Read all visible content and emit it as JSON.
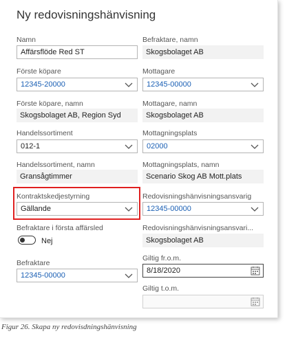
{
  "title": "Ny redovisningshänvisning",
  "left": {
    "namn": {
      "label": "Namn",
      "value": "Affärsflöde Red ST"
    },
    "forste_kopare": {
      "label": "Förste köpare",
      "value": "12345-20000"
    },
    "forste_kopare_namn": {
      "label": "Förste köpare, namn",
      "value": "Skogsbolaget AB, Region Syd"
    },
    "handelssortiment": {
      "label": "Handelssortiment",
      "value": "012-1"
    },
    "handelssortiment_namn": {
      "label": "Handelssortiment, namn",
      "value": "Gransågtimmer"
    },
    "kontraktskedjestyrning": {
      "label": "Kontraktskedjestyrning",
      "value": "Gällande"
    },
    "befraktare_forsta": {
      "label": "Befraktare i första affärsled",
      "value": "Nej"
    },
    "befraktare": {
      "label": "Befraktare",
      "value": "12345-00000"
    }
  },
  "right": {
    "befraktare_namn": {
      "label": "Befraktare, namn",
      "value": "Skogsbolaget AB"
    },
    "mottagare": {
      "label": "Mottagare",
      "value": "12345-00000"
    },
    "mottagare_namn": {
      "label": "Mottagare, namn",
      "value": "Skogsbolaget AB"
    },
    "mottagningsplats": {
      "label": "Mottagningsplats",
      "value": "02000"
    },
    "mottagningsplats_namn": {
      "label": "Mottagningsplats, namn",
      "value": "Scenario Skog AB Mott.plats"
    },
    "redovisningsansvarig": {
      "label": "Redovisningshänvisningsansvarig",
      "value": "12345-00000"
    },
    "redovisningsansvarig_namn": {
      "label": "Redovisningshänvisningsansvari...",
      "value": "Skogsbolaget AB"
    },
    "giltig_from": {
      "label": "Giltig fr.o.m.",
      "value": "8/18/2020"
    },
    "giltig_tom": {
      "label": "Giltig t.o.m.",
      "value": ""
    }
  },
  "caption": "Figur 26. Skapa ny redovisdningshänvisning",
  "icons": {
    "dropdown": "chevron-down-icon",
    "date": "calendar-icon",
    "toggle": "toggle-switch"
  },
  "colors": {
    "link": "#1a5fb4",
    "highlight": "#e02020"
  }
}
